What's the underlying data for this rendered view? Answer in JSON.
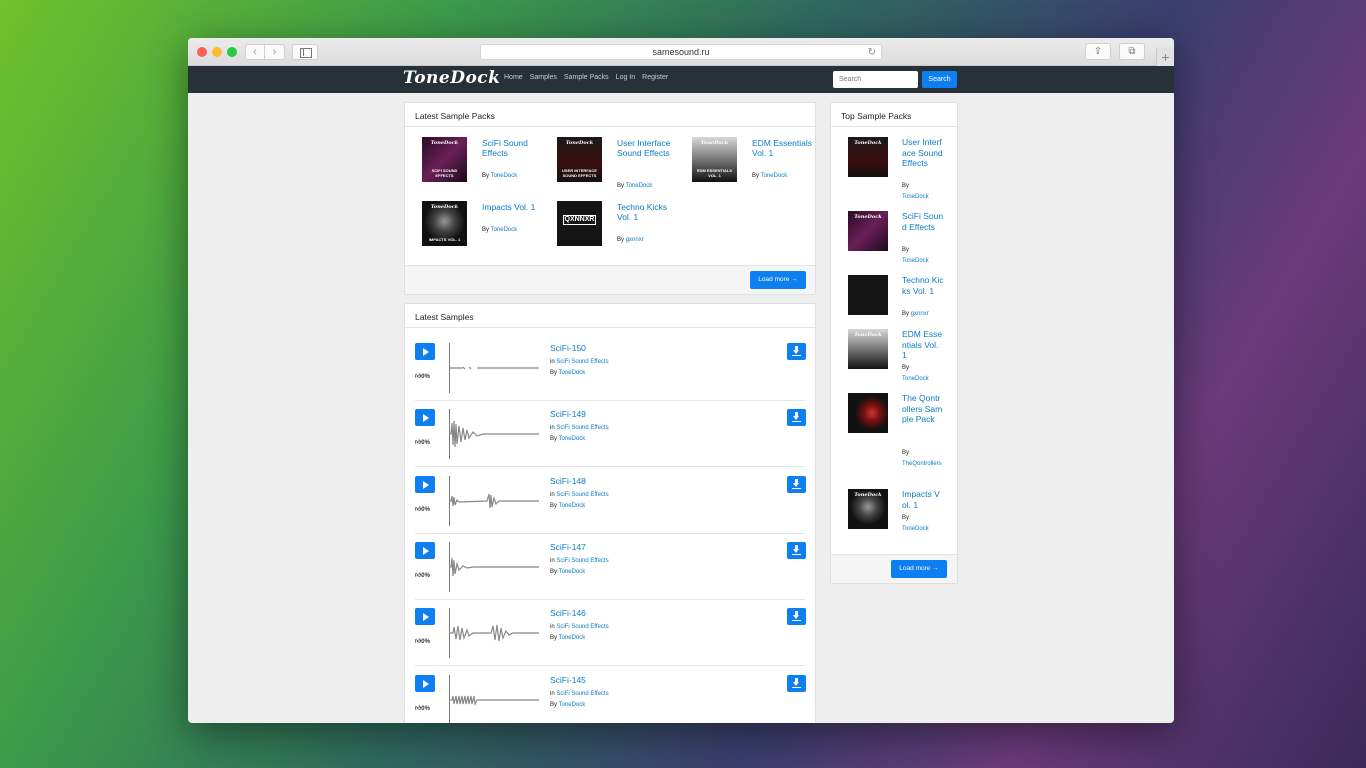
{
  "browser": {
    "url": "samesound.ru",
    "back": "‹",
    "forward": "›",
    "reload": "↻",
    "share": "⇪",
    "tabs": "⧉",
    "new_tab": "+"
  },
  "site": {
    "logo": "ToneDock",
    "nav": [
      "Home",
      "Samples",
      "Sample Packs",
      "Log In",
      "Register"
    ],
    "search_placeholder": "Search",
    "search_button": "Search"
  },
  "latest_packs": {
    "header": "Latest Sample Packs",
    "by_label": "By",
    "items": [
      {
        "title": "SciFi Sound Effects",
        "author": "ToneDock",
        "cover_text": "SCIFI SOUND EFFECTS"
      },
      {
        "title": "User Interface Sound Effects",
        "author": "ToneDock",
        "cover_text": "USER INTERFACE SOUND EFFECTS"
      },
      {
        "title": "EDM Essentials Vol. 1",
        "author": "ToneDock",
        "cover_text": "EDM ESSENTIALS VOL. 1"
      },
      {
        "title": "Impacts Vol. 1",
        "author": "ToneDock",
        "cover_text": "IMPACTS VOL. 1"
      },
      {
        "title": "Techno Kicks Vol. 1",
        "author": "gxnnxr",
        "cover_text": "QXNNXR"
      }
    ],
    "load_more": "Load more →"
  },
  "latest_samples": {
    "header": "Latest Samples",
    "in_label": "in",
    "by_label": "By",
    "items": [
      {
        "title": "SciFi-150",
        "pack": "SciFi Sound Effects",
        "author": "ToneDock",
        "likes": "0%"
      },
      {
        "title": "SciFi-149",
        "pack": "SciFi Sound Effects",
        "author": "ToneDock",
        "likes": "0%"
      },
      {
        "title": "SciFi-148",
        "pack": "SciFi Sound Effects",
        "author": "ToneDock",
        "likes": "0%"
      },
      {
        "title": "SciFi-147",
        "pack": "SciFi Sound Effects",
        "author": "ToneDock",
        "likes": "0%"
      },
      {
        "title": "SciFi-146",
        "pack": "SciFi Sound Effects",
        "author": "ToneDock",
        "likes": "0%"
      },
      {
        "title": "SciFi-145",
        "pack": "SciFi Sound Effects",
        "author": "ToneDock",
        "likes": "0%"
      }
    ]
  },
  "top_packs": {
    "header": "Top Sample Packs",
    "by_label": "By",
    "items": [
      {
        "title": "User Interface Sound Effects",
        "author": "ToneDock"
      },
      {
        "title": "SciFi Sound Effects",
        "author": "ToneDock"
      },
      {
        "title": "Techno Kicks Vol. 1",
        "author": "gxnnxr"
      },
      {
        "title": "EDM Essentials Vol. 1",
        "author": "ToneDock"
      },
      {
        "title": "The Qontrollers Sample Pack",
        "author": "TheQontrollers"
      },
      {
        "title": "Impacts Vol. 1",
        "author": "ToneDock"
      }
    ],
    "load_more": "Load more →"
  },
  "colors": {
    "accent": "#0d7ff0",
    "link": "#0b7cc4",
    "navbar": "#263238"
  }
}
